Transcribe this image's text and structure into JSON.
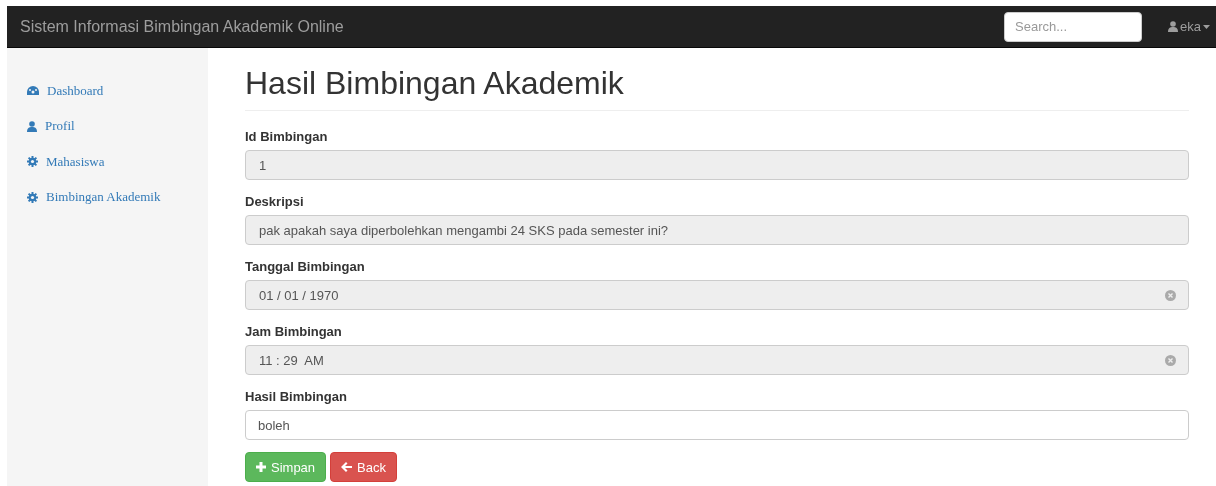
{
  "navbar": {
    "brand": "Sistem Informasi Bimbingan Akademik Online",
    "search": {
      "placeholder": "Search..."
    },
    "user": "eka"
  },
  "sidebar": {
    "items": [
      {
        "label": "Dashboard",
        "kind": "dashboard"
      },
      {
        "label": "Profil",
        "kind": "user"
      },
      {
        "label": "Mahasiswa",
        "kind": "gear"
      },
      {
        "label": "Bimbingan Akademik",
        "kind": "gear"
      }
    ]
  },
  "page": {
    "title": "Hasil Bimbingan Akademik"
  },
  "form": {
    "fields": [
      {
        "label": "Id Bimbingan",
        "value": "1",
        "disabled": true,
        "clearable": false
      },
      {
        "label": "Deskripsi",
        "value": "pak apakah saya diperbolehkan mengambi 24 SKS pada semester ini?",
        "disabled": true,
        "clearable": false
      },
      {
        "label": "Tanggal Bimbingan",
        "value": "01 / 01 / 1970",
        "disabled": true,
        "clearable": true
      },
      {
        "label": "Jam Bimbingan",
        "value": "11 : 29  AM",
        "disabled": true,
        "clearable": true
      },
      {
        "label": "Hasil Bimbingan",
        "value": "boleh",
        "disabled": false,
        "clearable": false
      }
    ],
    "buttons": [
      {
        "label": "Simpan",
        "kind": "primary"
      },
      {
        "label": "Back",
        "kind": "back"
      }
    ]
  }
}
